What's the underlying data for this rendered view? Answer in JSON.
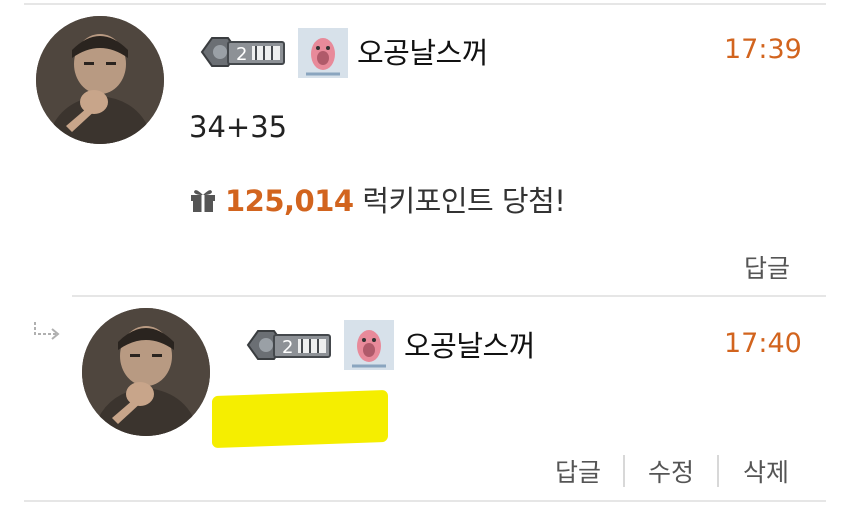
{
  "comments": [
    {
      "level": "2",
      "nickname": "오공날스꺼",
      "time": "17:39",
      "text": "34+35",
      "lucky_points": "125,014",
      "lucky_suffix": "럭키포인트 당첨!",
      "actions": [
        "답글"
      ]
    },
    {
      "is_reply": true,
      "level": "2",
      "nickname": "오공날스꺼",
      "time": "17:40",
      "actions": [
        "답글",
        "수정",
        "삭제"
      ]
    }
  ],
  "colors": {
    "accent": "#d2641e",
    "highlight": "#f5ee00",
    "divider": "#e6e6e6"
  },
  "icons": [
    "gift-icon",
    "level-badge-icon",
    "character-icon",
    "reply-arrow-icon"
  ]
}
